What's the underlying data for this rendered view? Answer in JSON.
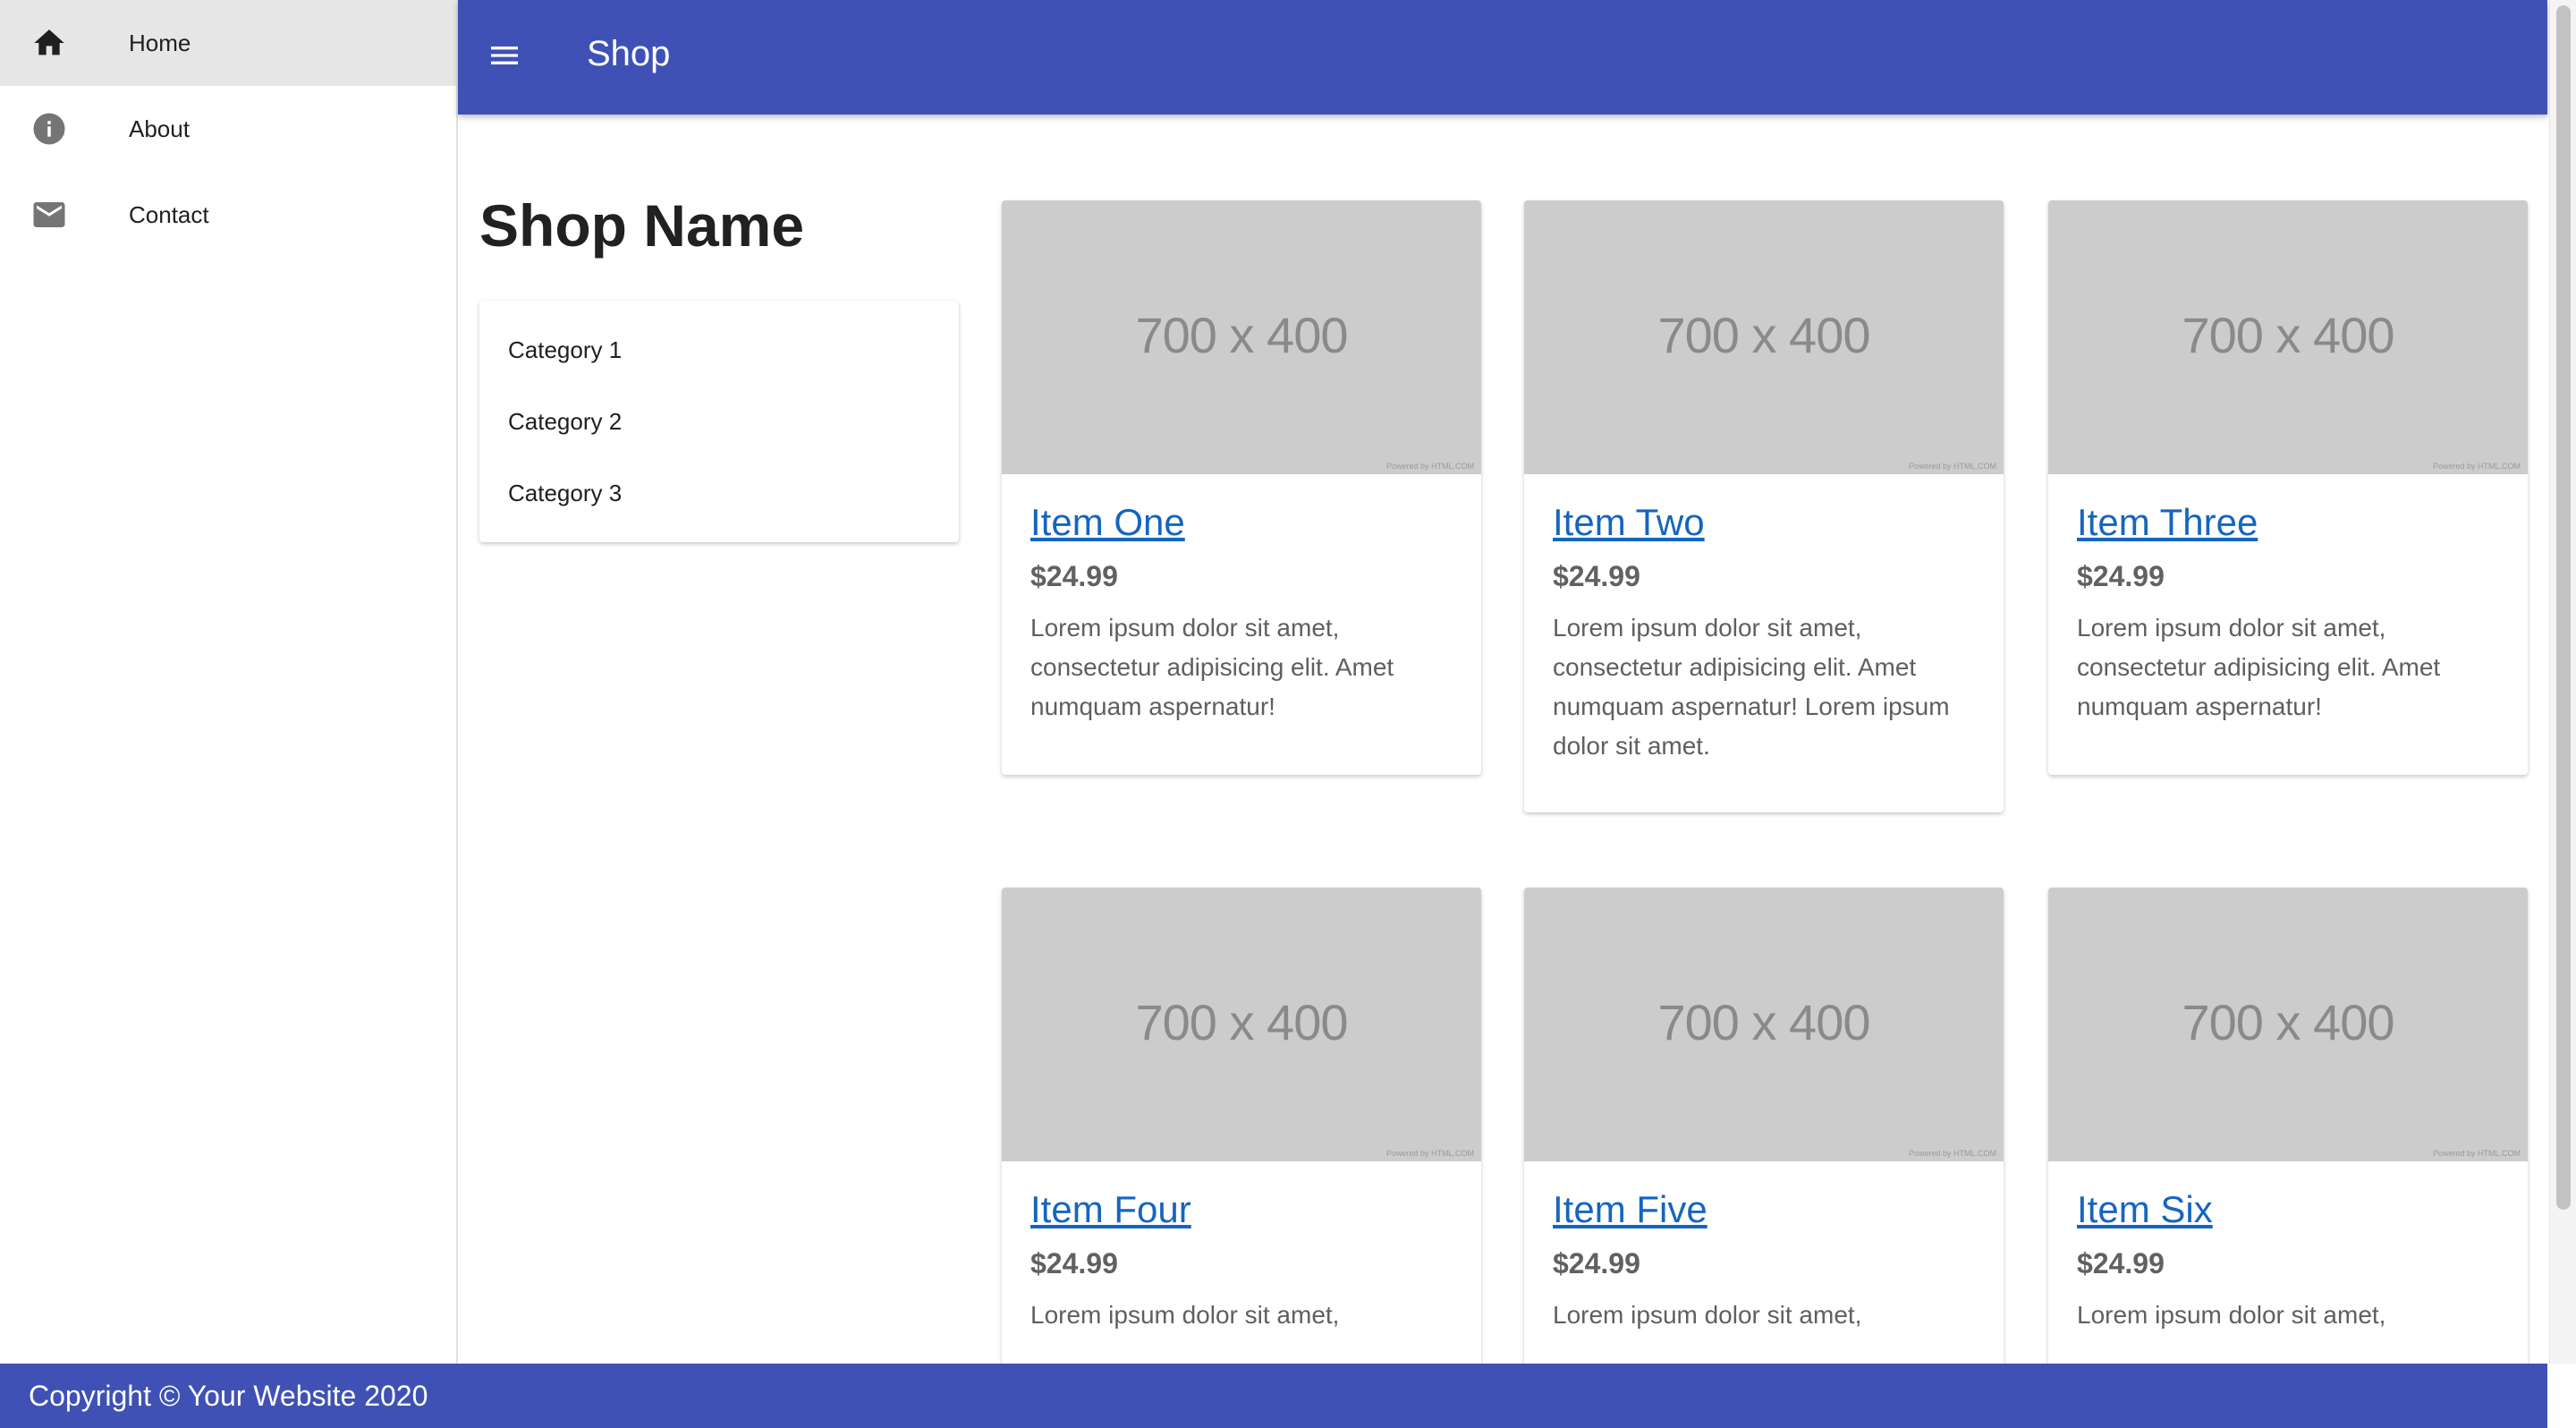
{
  "sidebar": {
    "items": [
      {
        "label": "Home",
        "icon": "home-icon",
        "active": true
      },
      {
        "label": "About",
        "icon": "info-icon",
        "active": false
      },
      {
        "label": "Contact",
        "icon": "mail-icon",
        "active": false
      }
    ]
  },
  "appbar": {
    "title": "Shop",
    "menu_icon": "menu-icon",
    "color": "#3f51b5"
  },
  "main": {
    "shop_name": "Shop Name",
    "categories": [
      "Category 1",
      "Category 2",
      "Category 3"
    ],
    "products": [
      {
        "image_text": "700 x 400",
        "image_credit": "Powered by HTML.COM",
        "title": "Item One",
        "price": "$24.99",
        "description": "Lorem ipsum dolor sit amet, consectetur adipisicing elit. Amet numquam aspernatur!"
      },
      {
        "image_text": "700 x 400",
        "image_credit": "Powered by HTML.COM",
        "title": "Item Two",
        "price": "$24.99",
        "description": "Lorem ipsum dolor sit amet, consectetur adipisicing elit. Amet numquam aspernatur! Lorem ipsum dolor sit amet."
      },
      {
        "image_text": "700 x 400",
        "image_credit": "Powered by HTML.COM",
        "title": "Item Three",
        "price": "$24.99",
        "description": "Lorem ipsum dolor sit amet, consectetur adipisicing elit. Amet numquam aspernatur!"
      },
      {
        "image_text": "700 x 400",
        "image_credit": "Powered by HTML.COM",
        "title": "Item Four",
        "price": "$24.99",
        "description": "Lorem ipsum dolor sit amet,"
      },
      {
        "image_text": "700 x 400",
        "image_credit": "Powered by HTML.COM",
        "title": "Item Five",
        "price": "$24.99",
        "description": "Lorem ipsum dolor sit amet,"
      },
      {
        "image_text": "700 x 400",
        "image_credit": "Powered by HTML.COM",
        "title": "Item Six",
        "price": "$24.99",
        "description": "Lorem ipsum dolor sit amet,"
      }
    ]
  },
  "footer": {
    "text": "Copyright © Your Website 2020"
  },
  "colors": {
    "primary": "#3f51b5",
    "link": "#1565c0",
    "placeholder": "#cccccc"
  }
}
